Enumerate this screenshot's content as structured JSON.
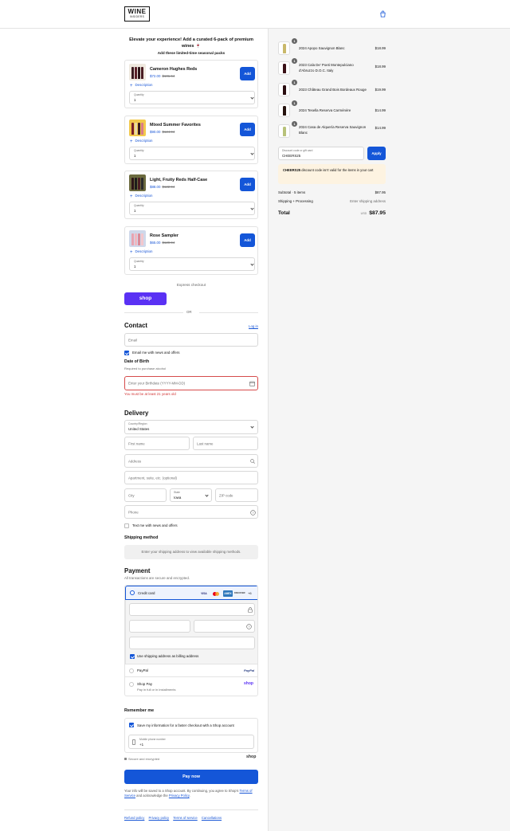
{
  "header": {
    "logo_line1": "WINE",
    "logo_line2": "INSIDERS",
    "cart_icon": "bag-icon"
  },
  "upsell": {
    "title": "Elevate your experience! Add a curated 6-pack of premium wines 🍷",
    "subtitle": "Add these limited-time seasonal packs",
    "add_label": "Add",
    "description_label": "Description",
    "quantity_label": "Quantity",
    "products": [
      {
        "name": "Cameron Hughes Reds",
        "price": "$72.00",
        "compare": "$101.64",
        "qty": "1"
      },
      {
        "name": "Mixed Summer Favorites",
        "price": "$90.00",
        "compare": "$124.94",
        "qty": "1"
      },
      {
        "name": "Light, Fruity Reds Half-Case",
        "price": "$88.00",
        "compare": "$122.94",
        "qty": "1"
      },
      {
        "name": "Rose Sampler",
        "price": "$65.00",
        "compare": "$120.94",
        "qty": "1"
      }
    ]
  },
  "express": {
    "label": "Express checkout",
    "shop_label": "shop",
    "or_label": "OR"
  },
  "contact": {
    "heading": "Contact",
    "login": "Log in",
    "email_placeholder": "Email",
    "news_label": "Email me with news and offers",
    "dob_heading": "Date of Birth",
    "dob_sub": "Required to purchase alcohol",
    "dob_placeholder": "Enter your Birthdate (YYYY-MM-DD)",
    "dob_error": "You must be at least 21 years old"
  },
  "delivery": {
    "heading": "Delivery",
    "country_label": "Country/Region",
    "country_value": "United States",
    "first_name": "First name",
    "last_name": "Last name",
    "address": "Address",
    "apartment": "Apartment, suite, etc. (optional)",
    "city": "City",
    "state_label": "State",
    "state_value": "Iowa",
    "zip": "ZIP code",
    "phone": "Phone",
    "text_label": "Text me with news and offers",
    "shipping_heading": "Shipping method",
    "shipping_info": "Enter your shipping address to view available shipping methods."
  },
  "payment": {
    "heading": "Payment",
    "sub": "All transactions are secure and encrypted.",
    "credit_card": "Credit card",
    "brands": [
      "VISA",
      "MC",
      "AMEX",
      "DISCOVER"
    ],
    "more_brands": "+6",
    "billing_label": "Use shipping address as billing address",
    "paypal": "PayPal",
    "paypal_logo": "PayPal",
    "shop_pay": "Shop Pay",
    "shop_pay_sub": "Pay in full or in installments",
    "shop_pay_logo": "shop"
  },
  "remember": {
    "heading": "Remember me",
    "save_label": "Save my information for a faster checkout with a Shop account",
    "mobile_label": "Mobile phone number",
    "mobile_value": "+1",
    "secure": "Secure and encrypted",
    "shop_logo": "shop"
  },
  "pay_now": "Pay now",
  "legal": {
    "text1": "Your info will be saved to a Shop account. By continuing, you agree to Shop’s",
    "tos": "Terms of Service",
    "mid": " and acknowledge the ",
    "privacy": "Privacy Policy",
    "end": "."
  },
  "footer": [
    "Refund policy",
    "Privacy policy",
    "Terms of service",
    "Cancellations"
  ],
  "summary": {
    "items": [
      {
        "qty": "1",
        "name": "2024 Apopo Sauvignon Blanc",
        "price": "$18.99",
        "color": "#c9b86a"
      },
      {
        "qty": "1",
        "name": "2023 Cala De' Poeti Montepulciano d'Abruzzo D.O.C. Italy",
        "price": "$18.99",
        "color": "#3a1016"
      },
      {
        "qty": "1",
        "name": "2023 Château Grand Bois Bordeaux Rouge",
        "price": "$19.99",
        "color": "#2a0d10"
      },
      {
        "qty": "1",
        "name": "2024 Tesella Reserva Carménère",
        "price": "$14.99",
        "color": "#26140f"
      },
      {
        "qty": "1",
        "name": "2024 Casa de Alquería Reserva Sauvignon Blanc",
        "price": "$14.99",
        "color": "#b8c27a"
      }
    ],
    "discount_label": "Discount code or gift card",
    "discount_value": "CHEERS25",
    "apply": "Apply",
    "notice_code": "CHEERS25",
    "notice_text": " discount code isn't valid for the items in your cart",
    "subtotal_label": "Subtotal · 5 items",
    "subtotal_value": "$87.95",
    "shipping_label": "Shipping + Processing",
    "shipping_value": "Enter shipping address",
    "total_label": "Total",
    "currency": "USD",
    "total_value": "$87.95"
  },
  "colors": {
    "accent": "#1456d8",
    "shop_purple": "#5a31f4",
    "error": "#d13535"
  }
}
